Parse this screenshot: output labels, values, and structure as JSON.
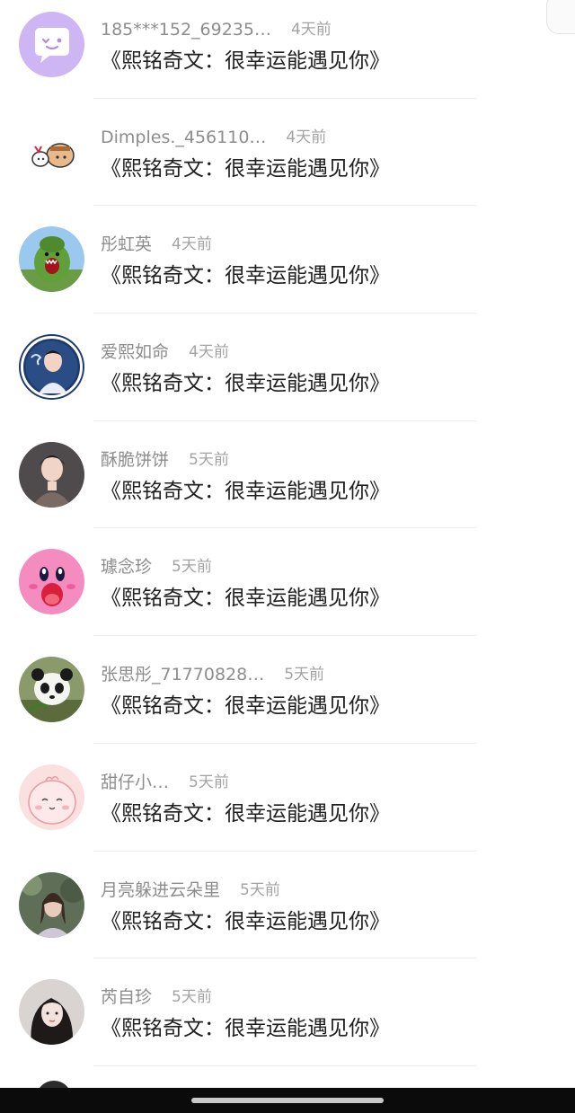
{
  "comments": [
    {
      "username": "185***152_69235…",
      "time": "4天前",
      "text": "《熙铭奇文：很幸运能遇见你》",
      "avatar": "purple-chat-bubble-avatar",
      "name_width": 184
    },
    {
      "username": "Dimples._456110…",
      "time": "4天前",
      "text": "《熙铭奇文：很幸运能遇见你》",
      "avatar": "cartoon-sketch-avatar",
      "name_width": 180
    },
    {
      "username": "彤虹英",
      "time": "4天前",
      "text": "《熙铭奇文：很幸运能遇见你》",
      "avatar": "green-toy-avatar",
      "name_width": 58
    },
    {
      "username": "爱熙如命",
      "time": "4天前",
      "text": "《熙铭奇文：很幸运能遇见你》",
      "avatar": "idol-photo-avatar",
      "name_width": 80
    },
    {
      "username": "酥脆饼饼",
      "time": "5天前",
      "text": "《熙铭奇文：很幸运能遇见你》",
      "avatar": "person-photo-avatar",
      "name_width": 80
    },
    {
      "username": "璩念珍",
      "time": "5天前",
      "text": "《熙铭奇文：很幸运能遇见你》",
      "avatar": "kirby-avatar",
      "name_width": 58
    },
    {
      "username": "张思彤_71770828…",
      "time": "5天前",
      "text": "《熙铭奇文：很幸运能遇见你》",
      "avatar": "panda-avatar",
      "name_width": 184
    },
    {
      "username": "甜仔小…",
      "time": "5天前",
      "text": "《熙铭奇文：很幸运能遇见你》",
      "avatar": "pink-blob-avatar",
      "name_width": 78
    },
    {
      "username": "月亮躲进云朵里",
      "time": "5天前",
      "text": "《熙铭奇文：很幸运能遇见你》",
      "avatar": "forest-girl-avatar",
      "name_width": 142
    },
    {
      "username": "芮自珍",
      "time": "5天前",
      "text": "《熙铭奇文：很幸运能遇见你》",
      "avatar": "girl-portrait-avatar",
      "name_width": 58
    }
  ]
}
